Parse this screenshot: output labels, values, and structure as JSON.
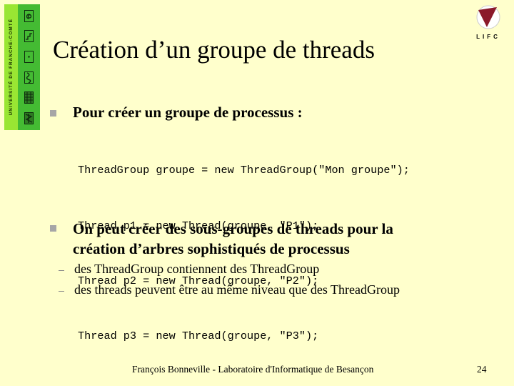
{
  "branding": {
    "university_band_text": "UNIVERSITÉ DE FRANCHE-COMTÉ",
    "band_icons": [
      "spiral-glyph-icon",
      "stair-glyph-icon",
      "dot-glyph-icon",
      "squiggle-glyph-icon",
      "grid-glyph-icon",
      "figure-glyph-icon"
    ],
    "lab_logo_text": "LIFC",
    "colors": {
      "background": "#ffffcc",
      "band_light": "#99e633",
      "band_dark": "#44bb33",
      "logo_red": "#8b1a2a",
      "bullet": "#a6a6a6"
    }
  },
  "slide": {
    "title": "Création d’un groupe de threads",
    "bullets": [
      {
        "text": "Pour créer un groupe de processus :",
        "code": [
          "ThreadGroup groupe = new ThreadGroup(\"Mon groupe\");",
          "Thread p1 = new Thread(groupe, \"P1\");",
          "Thread p2 = new Thread(groupe, \"P2\");",
          "Thread p3 = new Thread(groupe, \"P3\");"
        ]
      },
      {
        "text_line1": "On peut créer des sous-groupes de threads pour la",
        "text_line2": "création d’arbres sophistiqués de processus",
        "subitems": [
          "des ThreadGroup contiennent des ThreadGroup",
          "des threads peuvent être au même niveau que des ThreadGroup"
        ]
      }
    ]
  },
  "footer": {
    "text": "François Bonneville - Laboratoire d'Informatique de Besançon",
    "page_number": "24"
  }
}
